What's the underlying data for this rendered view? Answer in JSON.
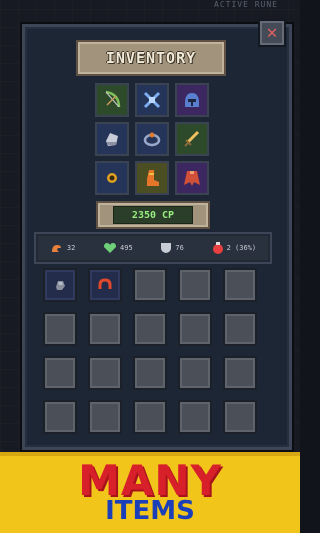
{
  "top_label": "ACTIVE RUNE",
  "window": {
    "title": "INVENTORY",
    "close_label": "✕",
    "combat_power": "2350 CP"
  },
  "equipment": [
    {
      "name": "bow-icon",
      "bg": "#2d4a2b"
    },
    {
      "name": "crossed-weapons-icon",
      "bg": "#253459"
    },
    {
      "name": "helmet-icon",
      "bg": "#3c2760"
    },
    {
      "name": "gauntlet-icon",
      "bg": "#253459"
    },
    {
      "name": "ring-icon",
      "bg": "#253459"
    },
    {
      "name": "sword-icon",
      "bg": "#2d4a2b"
    },
    {
      "name": "amulet-icon",
      "bg": "#253459"
    },
    {
      "name": "boots-icon",
      "bg": "#4b4d22"
    },
    {
      "name": "cape-icon",
      "bg": "#3c2760"
    }
  ],
  "stats": [
    {
      "icon": "strength-arm-icon",
      "value": "32"
    },
    {
      "icon": "health-heart-icon",
      "value": "495"
    },
    {
      "icon": "armor-shield-icon",
      "value": "76"
    },
    {
      "icon": "crit-potion-icon",
      "value": "2 (36%)"
    }
  ],
  "inventory_items": [
    {
      "name": "stone-item-icon"
    },
    {
      "name": "horseshoe-ring-item-icon"
    }
  ],
  "banner": {
    "line1": "MANY",
    "line2": "ITEMS"
  }
}
